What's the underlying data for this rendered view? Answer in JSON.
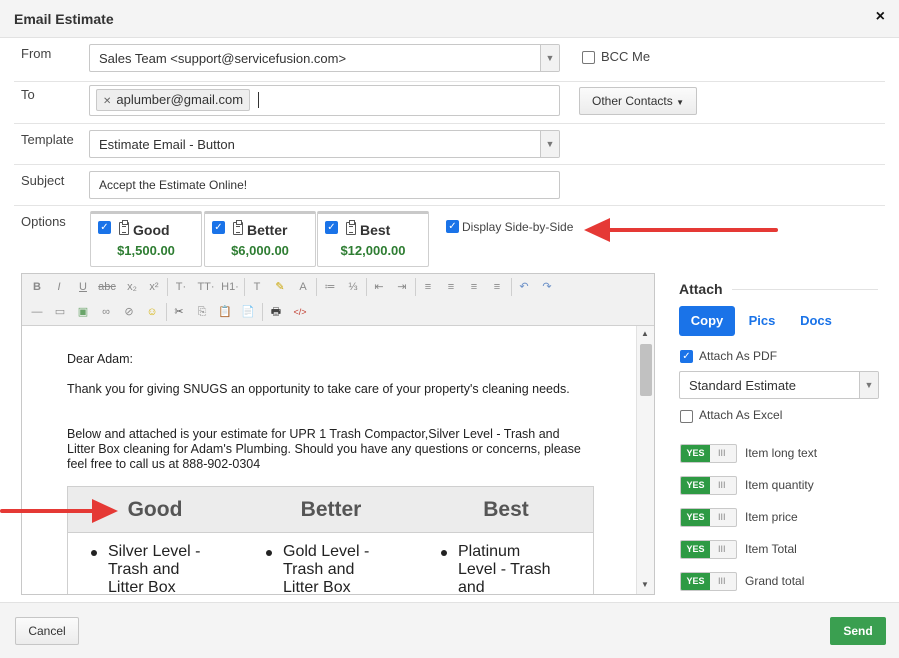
{
  "dialog": {
    "title": "Email Estimate",
    "close_icon": "×"
  },
  "from": {
    "label": "From",
    "value": "Sales Team <support@servicefusion.com>",
    "bcc_label": "BCC Me",
    "bcc_checked": false
  },
  "to": {
    "label": "To",
    "recipient": "aplumber@gmail.com",
    "other_contacts_label": "Other Contacts"
  },
  "template": {
    "label": "Template",
    "value": "Estimate Email - Button"
  },
  "subject": {
    "label": "Subject",
    "value": "Accept the Estimate Online!"
  },
  "options": {
    "label": "Options",
    "cards": [
      {
        "name": "Good",
        "price": "$1,500.00",
        "checked": true
      },
      {
        "name": "Better",
        "price": "$6,000.00",
        "checked": true
      },
      {
        "name": "Best",
        "price": "$12,000.00",
        "checked": true
      }
    ],
    "side_by_side_label": "Display Side-by-Side",
    "side_by_side_checked": true
  },
  "editor": {
    "toolbar_row1": [
      "B",
      "I",
      "U",
      "abc",
      "x₂",
      "x²",
      "T·",
      "TT·",
      "H1·",
      "T",
      "✎",
      "A",
      "≔",
      "⅓",
      "⇤",
      "⇥",
      "≡",
      "≡",
      "≡",
      "≡",
      "↶",
      "↷"
    ],
    "toolbar_row2": [
      "—",
      "▭",
      "▣",
      "∞",
      "⊘",
      "☺",
      "✂",
      "⎘",
      "📋",
      "📄",
      "🖶",
      "</>"
    ],
    "greeting": "Dear Adam:",
    "paragraph1": "Thank you for giving SNUGS an opportunity to take care of your property's cleaning needs.",
    "paragraph2": "Below and attached is your estimate for UPR 1 Trash Compactor,Silver Level - Trash and Litter Box cleaning for Adam's Plumbing. Should you have any questions or concerns, please feel free to call us at 888-902-0304",
    "table_headers": [
      "Good",
      "Better",
      "Best"
    ],
    "table_items": [
      "Silver Level - Trash and Litter Box",
      "Gold Level - Trash and Litter Box",
      "Platinum Level - Trash and"
    ]
  },
  "attach": {
    "title": "Attach",
    "tabs": [
      "Copy",
      "Pics",
      "Docs"
    ],
    "active_tab": "Copy",
    "pdf_label": "Attach As PDF",
    "pdf_checked": true,
    "pdf_format": "Standard Estimate",
    "excel_label": "Attach As Excel",
    "excel_checked": false,
    "toggle_yes": "YES",
    "toggle_grip": "III",
    "toggles": [
      {
        "label": "Item long text",
        "on": true
      },
      {
        "label": "Item quantity",
        "on": true
      },
      {
        "label": "Item price",
        "on": true
      },
      {
        "label": "Item Total",
        "on": true
      },
      {
        "label": "Grand total",
        "on": true
      }
    ]
  },
  "footer": {
    "cancel_label": "Cancel",
    "send_label": "Send"
  },
  "colors": {
    "accent_blue": "#1a73e8",
    "green": "#2e9a44",
    "arrow_red": "#e53935"
  }
}
